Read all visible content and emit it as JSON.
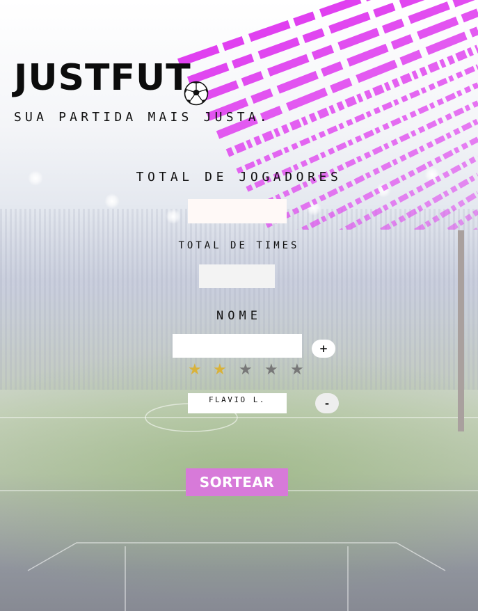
{
  "app": {
    "logo": "JUSTFUT",
    "tagline": "SUA PARTIDA MAIS JUSTA."
  },
  "form": {
    "total_players_label": "TOTAL DE JOGADORES",
    "total_players_value": "",
    "total_teams_label": "TOTAL DE TIMES",
    "total_teams_value": "",
    "name_label": "NOME",
    "name_value": "",
    "add_label": "+",
    "rating": {
      "value": 2,
      "max": 5,
      "star_glyph": "★"
    }
  },
  "players": [
    {
      "name": "FLAVIO L.",
      "remove_label": "-"
    }
  ],
  "actions": {
    "draw_label": "SORTEAR"
  },
  "colors": {
    "accent": "#d77ad9",
    "stripes": "#e040f0",
    "star_filled": "#d9b23a",
    "star_empty": "#777777"
  },
  "icons": {
    "ball": "soccer-ball-icon"
  }
}
